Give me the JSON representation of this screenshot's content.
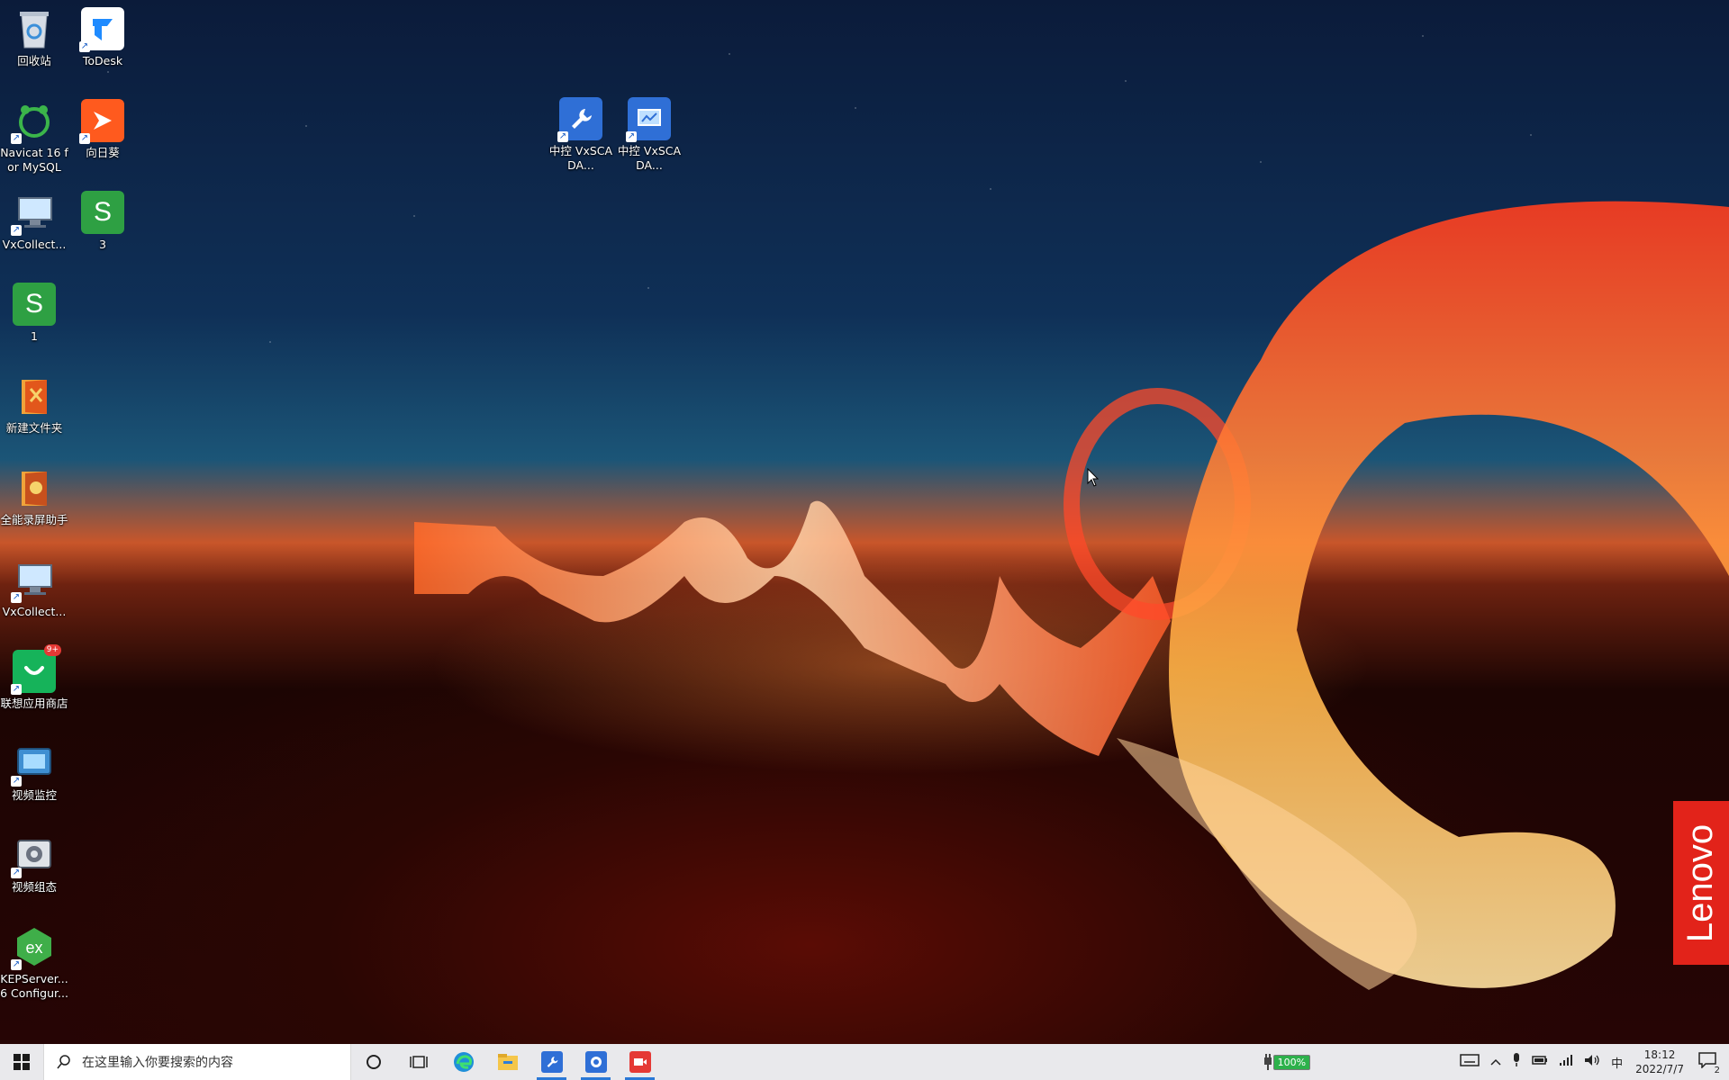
{
  "desktop_icons": [
    {
      "label": "回收站",
      "icon": "recycle-bin-icon"
    },
    {
      "label": "ToDesk",
      "icon": "todesk-icon"
    },
    {
      "label": "Navicat 16 for MySQL",
      "icon": "navicat-icon"
    },
    {
      "label": "向日葵",
      "icon": "sunlogin-icon"
    },
    {
      "label": "VxCollect...",
      "icon": "vxcollect-icon"
    },
    {
      "label": "3",
      "icon": "wps-sheet-icon"
    },
    {
      "label": "1",
      "icon": "wps-sheet-icon"
    },
    {
      "label": "新建文件夹",
      "icon": "folder-icon"
    },
    {
      "label": "全能录屏助手",
      "icon": "screen-recorder-icon"
    },
    {
      "label": "VxCollect...",
      "icon": "vxcollect-icon"
    },
    {
      "label": "联想应用商店",
      "icon": "lenovo-app-store-icon",
      "badge": "9+"
    },
    {
      "label": "视频监控",
      "icon": "video-monitor-icon"
    },
    {
      "label": "视频组态",
      "icon": "video-config-icon"
    },
    {
      "label": "KEPServer... 6 Configur...",
      "icon": "kepserver-icon"
    },
    {
      "label": "中控 VxSCADA...",
      "icon": "vxscada-tool-icon"
    },
    {
      "label": "中控 VxSCADA...",
      "icon": "vxscada-monitor-icon"
    }
  ],
  "wallpaper": {
    "brand": "Lenovo",
    "brand_color": "#e2231a"
  },
  "taskbar": {
    "search_placeholder": "在这里输入你要搜索的内容",
    "apps": [
      {
        "name": "edge-icon",
        "active": false
      },
      {
        "name": "file-explorer-icon",
        "active": false
      },
      {
        "name": "vxscada-tool-icon",
        "active": true
      },
      {
        "name": "settings-app-icon",
        "active": true
      },
      {
        "name": "screen-recorder-icon",
        "active": true
      }
    ],
    "battery": "100%",
    "ime": "中",
    "time": "18:12",
    "date": "2022/7/7",
    "notifications": "2"
  }
}
